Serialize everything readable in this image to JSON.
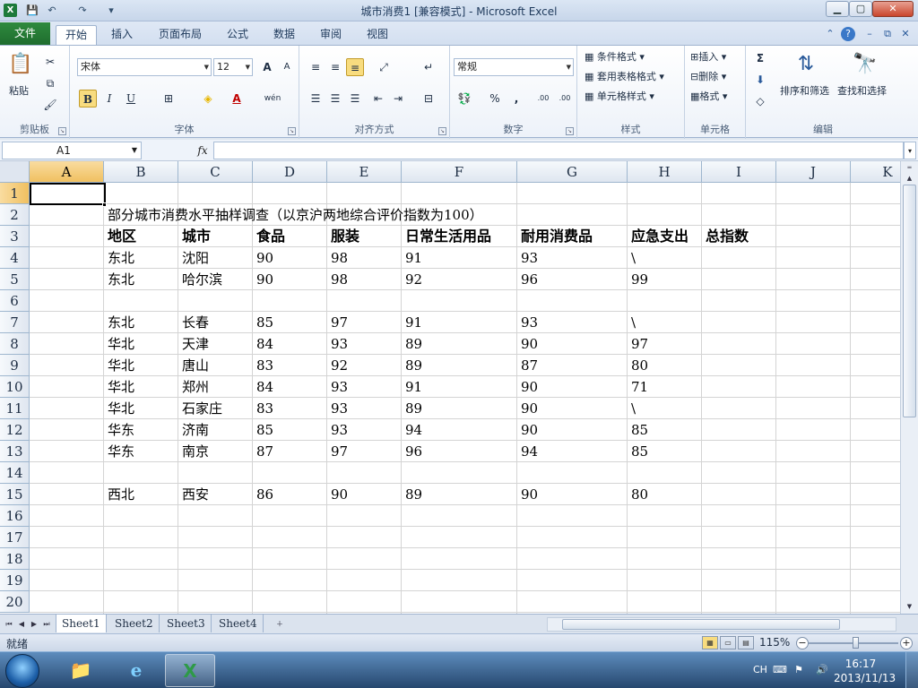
{
  "window": {
    "title": "城市消费1 [兼容模式] - Microsoft Excel",
    "app_icon_letter": "X",
    "qat": [
      "save-icon",
      "undo-icon",
      "redo-icon",
      "customize-icon"
    ],
    "controls": {
      "minimize": "▁",
      "maximize": "▢",
      "close": "✕"
    }
  },
  "tabs": {
    "file": "文件",
    "items": [
      "开始",
      "插入",
      "页面布局",
      "公式",
      "数据",
      "审阅",
      "视图"
    ],
    "active": "开始"
  },
  "ribbon": {
    "clipboard": {
      "label": "剪贴板",
      "paste": "粘贴"
    },
    "font": {
      "label": "字体",
      "name": "宋体",
      "size": "12",
      "bold": "B",
      "italic": "I",
      "underline": "U",
      "grow": "A",
      "shrink": "A",
      "phonetic": "wén"
    },
    "alignment": {
      "label": "对齐方式"
    },
    "number": {
      "label": "数字",
      "format": "常规",
      "percent": "%",
      "comma": ",",
      "inc_decimal": ".00",
      "dec_decimal": ".00"
    },
    "styles": {
      "label": "样式",
      "conditional": "条件格式",
      "table": "套用表格格式",
      "cell": "单元格样式"
    },
    "cells": {
      "label": "单元格",
      "insert": "插入",
      "delete": "删除",
      "format": "格式"
    },
    "editing": {
      "label": "编辑",
      "sort_filter": "排序和筛选",
      "find_select": "查找和选择",
      "sum": "Σ"
    }
  },
  "formula_bar": {
    "name_box": "A1",
    "fx": "fx",
    "value": ""
  },
  "columns": [
    "A",
    "B",
    "C",
    "D",
    "E",
    "F",
    "G",
    "H",
    "I",
    "J",
    "K"
  ],
  "rows": [
    "1",
    "2",
    "3",
    "4",
    "5",
    "6",
    "7",
    "8",
    "9",
    "10",
    "11",
    "12",
    "13",
    "14",
    "15",
    "16",
    "17",
    "18",
    "19",
    "20"
  ],
  "selected": {
    "column": "A",
    "row": "1"
  },
  "sheet": {
    "title_cell": "部分城市消费水平抽样调查（以京沪两地综合评价指数为100）",
    "headers": [
      "地区",
      "城市",
      "食品",
      "服装",
      "日常生活用品",
      "耐用消费品",
      "应急支出",
      "总指数"
    ],
    "data_rows": [
      {
        "row": 4,
        "cells": [
          "东北",
          "沈阳",
          "90",
          "98",
          "91",
          "93",
          "\\"
        ]
      },
      {
        "row": 5,
        "cells": [
          "东北",
          "哈尔滨",
          "90",
          "98",
          "92",
          "96",
          "99"
        ]
      },
      {
        "row": 7,
        "cells": [
          "东北",
          "长春",
          "85",
          "97",
          "91",
          "93",
          "\\"
        ]
      },
      {
        "row": 8,
        "cells": [
          "华北",
          "天津",
          "84",
          "93",
          "89",
          "90",
          "97"
        ]
      },
      {
        "row": 9,
        "cells": [
          "华北",
          "唐山",
          "83",
          "92",
          "89",
          "87",
          "80"
        ]
      },
      {
        "row": 10,
        "cells": [
          "华北",
          "郑州",
          "84",
          "93",
          "91",
          "90",
          "71"
        ]
      },
      {
        "row": 11,
        "cells": [
          "华北",
          "石家庄",
          "83",
          "93",
          "89",
          "90",
          "\\"
        ]
      },
      {
        "row": 12,
        "cells": [
          "华东",
          "济南",
          "85",
          "93",
          "94",
          "90",
          "85"
        ]
      },
      {
        "row": 13,
        "cells": [
          "华东",
          "南京",
          "87",
          "97",
          "96",
          "94",
          "85"
        ]
      },
      {
        "row": 15,
        "cells": [
          "西北",
          "西安",
          "86",
          "90",
          "89",
          "90",
          "80"
        ]
      }
    ]
  },
  "sheet_tabs": [
    "Sheet1",
    "Sheet2",
    "Sheet3",
    "Sheet4"
  ],
  "active_sheet": "Sheet1",
  "status": {
    "text": "就绪",
    "zoom": "115%",
    "zoom_level_percent": 115
  },
  "taskbar": {
    "ime": "CH",
    "time": "16:17",
    "date": "2013/11/13"
  }
}
